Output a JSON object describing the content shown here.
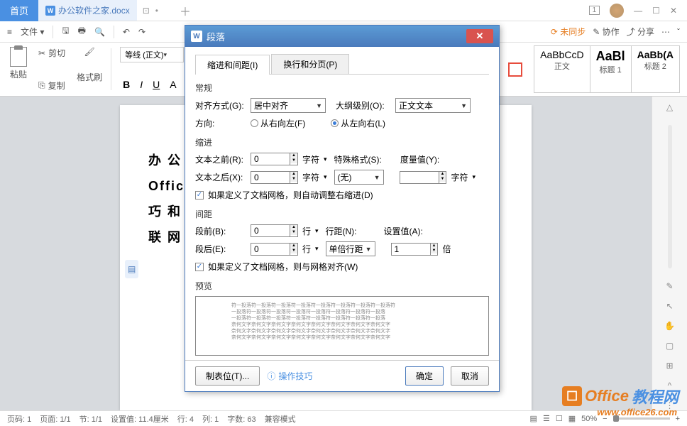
{
  "tabs": {
    "home": "首页",
    "doc_name": "办公软件之家.docx",
    "window_num": "1"
  },
  "menu": {
    "file": "文件",
    "sync": "未同步",
    "coop": "协作",
    "share": "分享"
  },
  "ribbon": {
    "paste": "粘贴",
    "cut": "剪切",
    "copy": "复制",
    "format_painter": "格式刷",
    "style_combo": "等线 (正文)",
    "bold": "B",
    "italic": "I",
    "underline": "U",
    "strike": "A",
    "styles": [
      {
        "preview": "AaBbCcD",
        "label": "正文"
      },
      {
        "preview": "AaBl",
        "label": "标题 1"
      },
      {
        "preview": "AaBb(A",
        "label": "标题 2"
      }
    ]
  },
  "document": {
    "lines": [
      "办 公",
      "Office",
      "巧 和",
      "联 网"
    ]
  },
  "dialog": {
    "title": "段落",
    "tab1": "缩进和间距(I)",
    "tab2": "换行和分页(P)",
    "section_general": "常规",
    "alignment_label": "对齐方式(G):",
    "alignment_value": "居中对齐",
    "outline_label": "大纲级别(O):",
    "outline_value": "正文文本",
    "direction_label": "方向:",
    "direction_rtl": "从右向左(F)",
    "direction_ltr": "从左向右(L)",
    "section_indent": "缩进",
    "indent_before_label": "文本之前(R):",
    "indent_before_value": "0",
    "indent_after_label": "文本之后(X):",
    "indent_after_value": "0",
    "unit_char": "字符",
    "special_label": "特殊格式(S):",
    "special_value": "(无)",
    "measure_label": "度量值(Y):",
    "auto_indent": "如果定义了文档网格，则自动调整右缩进(D)",
    "section_spacing": "间距",
    "space_before_label": "段前(B):",
    "space_before_value": "0",
    "space_after_label": "段后(E):",
    "space_after_value": "0",
    "unit_line": "行",
    "line_spacing_label": "行距(N):",
    "line_spacing_value": "单倍行距",
    "set_value_label": "设置值(A):",
    "set_value": "1",
    "unit_times": "倍",
    "snap_grid": "如果定义了文档网格，则与网格对齐(W)",
    "section_preview": "预览",
    "tabstops": "制表位(T)...",
    "tips": "操作技巧",
    "ok": "确定",
    "cancel": "取消"
  },
  "status": {
    "page_num": "页码: 1",
    "page": "页面: 1/1",
    "section": "节: 1/1",
    "set_value": "设置值: 11.4厘米",
    "row": "行: 4",
    "col": "列: 1",
    "chars": "字数: 63",
    "compat": "兼容模式",
    "zoom": "50%"
  },
  "watermark": {
    "text1": "Office",
    "text2": "教程网",
    "url": "www.office26.com"
  }
}
